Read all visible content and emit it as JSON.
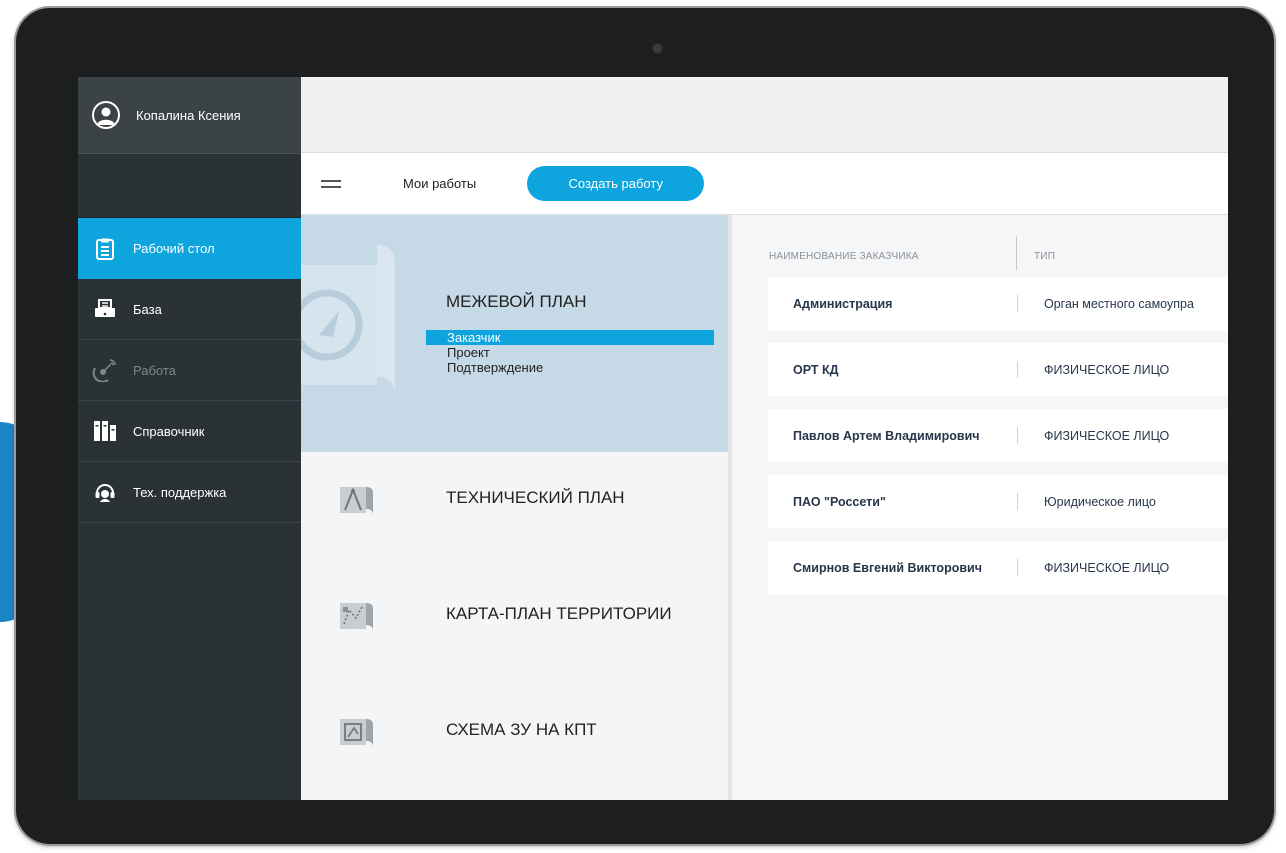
{
  "user": {
    "name": "Копалина Ксения",
    "icon": "user-circle-icon"
  },
  "sidebar": {
    "items": [
      {
        "label": "Рабочий стол",
        "icon": "clipboard-icon",
        "active": true
      },
      {
        "label": "База",
        "icon": "printer-icon"
      },
      {
        "label": "Работа",
        "icon": "satellite-icon",
        "disabled": true
      },
      {
        "label": "Справочник",
        "icon": "books-icon"
      },
      {
        "label": "Тех. поддержка",
        "icon": "headset-icon"
      }
    ]
  },
  "toolbar": {
    "my_works": "Мои работы",
    "create_label": "Создать работу"
  },
  "plans": {
    "active": {
      "title": "МЕЖЕВОЙ ПЛАН",
      "steps": [
        "Заказчик",
        "Проект",
        "Подтверждение"
      ]
    },
    "others": [
      {
        "title": "ТЕХНИЧЕСКИЙ ПЛАН",
        "icon": "drafting-compass-icon"
      },
      {
        "title": "КАРТА-ПЛАН ТЕРРИТОРИИ",
        "icon": "map-icon"
      },
      {
        "title": "СХЕМА ЗУ НА КПТ",
        "icon": "scheme-icon"
      }
    ]
  },
  "customers": {
    "headers": [
      "НАИМЕНОВАНИЕ ЗАКАЗЧИКА",
      "ТИП"
    ],
    "rows": [
      {
        "name": "Администрация",
        "type": "Орган местного самоупра"
      },
      {
        "name": "ОРТ КД",
        "type": "ФИЗИЧЕСКОЕ ЛИЦО"
      },
      {
        "name": "Павлов Артем Владимирович",
        "type": "ФИЗИЧЕСКОЕ ЛИЦО"
      },
      {
        "name": "ПАО \"Россети\"",
        "type": "Юридическое лицо"
      },
      {
        "name": "Смирнов Евгений Викторович",
        "type": "ФИЗИЧЕСКОЕ ЛИЦО"
      }
    ]
  },
  "colors": {
    "accent": "#0ea5df",
    "sidebar": "#2b3236",
    "active_card": "#c5d9e7"
  }
}
